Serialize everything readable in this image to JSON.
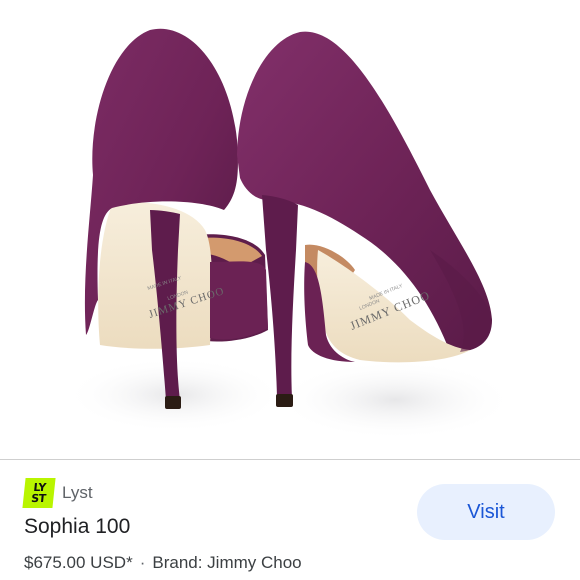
{
  "product_image": {
    "alt": "Purple suede pointed-toe pumps, rear view",
    "insole_brand_print": "JIMMY CHOO",
    "insole_sub_print": "LONDON",
    "insole_made_in": "MADE IN ITALY",
    "colors": {
      "suede": "#6e2357",
      "suede_dark": "#4c1339",
      "suede_light": "#8a3a72",
      "insole": "#f2e6cf",
      "lining": "#d39a6e",
      "heel_tip": "#2b1c14"
    }
  },
  "source": {
    "logo_line1": "LY",
    "logo_line2": "ST",
    "logo_color": "#b9f500",
    "name": "Lyst"
  },
  "product": {
    "title": "Sophia 100",
    "price": "$675.00 USD*",
    "separator": "·",
    "brand": "Brand: Jimmy Choo"
  },
  "actions": {
    "visit_label": "Visit",
    "visit_color": "#1a56d6",
    "visit_bg": "#e8f0fe"
  }
}
